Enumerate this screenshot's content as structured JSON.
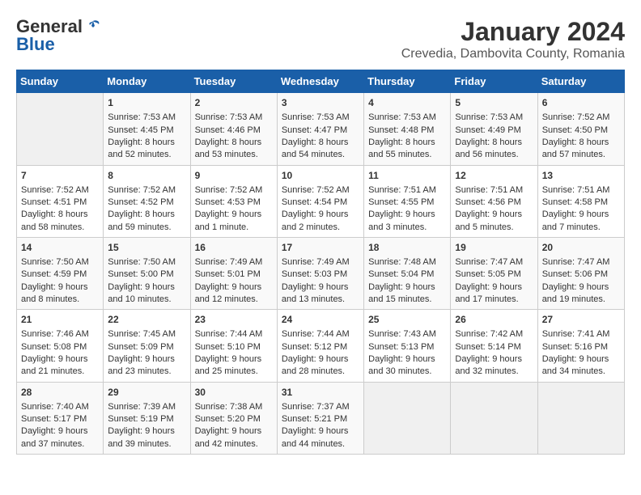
{
  "logo": {
    "general": "General",
    "blue": "Blue"
  },
  "title": "January 2024",
  "subtitle": "Crevedia, Dambovita County, Romania",
  "days_of_week": [
    "Sunday",
    "Monday",
    "Tuesday",
    "Wednesday",
    "Thursday",
    "Friday",
    "Saturday"
  ],
  "weeks": [
    [
      {
        "day": "",
        "content": ""
      },
      {
        "day": "1",
        "content": "Sunrise: 7:53 AM\nSunset: 4:45 PM\nDaylight: 8 hours\nand 52 minutes."
      },
      {
        "day": "2",
        "content": "Sunrise: 7:53 AM\nSunset: 4:46 PM\nDaylight: 8 hours\nand 53 minutes."
      },
      {
        "day": "3",
        "content": "Sunrise: 7:53 AM\nSunset: 4:47 PM\nDaylight: 8 hours\nand 54 minutes."
      },
      {
        "day": "4",
        "content": "Sunrise: 7:53 AM\nSunset: 4:48 PM\nDaylight: 8 hours\nand 55 minutes."
      },
      {
        "day": "5",
        "content": "Sunrise: 7:53 AM\nSunset: 4:49 PM\nDaylight: 8 hours\nand 56 minutes."
      },
      {
        "day": "6",
        "content": "Sunrise: 7:52 AM\nSunset: 4:50 PM\nDaylight: 8 hours\nand 57 minutes."
      }
    ],
    [
      {
        "day": "7",
        "content": "Sunrise: 7:52 AM\nSunset: 4:51 PM\nDaylight: 8 hours\nand 58 minutes."
      },
      {
        "day": "8",
        "content": "Sunrise: 7:52 AM\nSunset: 4:52 PM\nDaylight: 8 hours\nand 59 minutes."
      },
      {
        "day": "9",
        "content": "Sunrise: 7:52 AM\nSunset: 4:53 PM\nDaylight: 9 hours\nand 1 minute."
      },
      {
        "day": "10",
        "content": "Sunrise: 7:52 AM\nSunset: 4:54 PM\nDaylight: 9 hours\nand 2 minutes."
      },
      {
        "day": "11",
        "content": "Sunrise: 7:51 AM\nSunset: 4:55 PM\nDaylight: 9 hours\nand 3 minutes."
      },
      {
        "day": "12",
        "content": "Sunrise: 7:51 AM\nSunset: 4:56 PM\nDaylight: 9 hours\nand 5 minutes."
      },
      {
        "day": "13",
        "content": "Sunrise: 7:51 AM\nSunset: 4:58 PM\nDaylight: 9 hours\nand 7 minutes."
      }
    ],
    [
      {
        "day": "14",
        "content": "Sunrise: 7:50 AM\nSunset: 4:59 PM\nDaylight: 9 hours\nand 8 minutes."
      },
      {
        "day": "15",
        "content": "Sunrise: 7:50 AM\nSunset: 5:00 PM\nDaylight: 9 hours\nand 10 minutes."
      },
      {
        "day": "16",
        "content": "Sunrise: 7:49 AM\nSunset: 5:01 PM\nDaylight: 9 hours\nand 12 minutes."
      },
      {
        "day": "17",
        "content": "Sunrise: 7:49 AM\nSunset: 5:03 PM\nDaylight: 9 hours\nand 13 minutes."
      },
      {
        "day": "18",
        "content": "Sunrise: 7:48 AM\nSunset: 5:04 PM\nDaylight: 9 hours\nand 15 minutes."
      },
      {
        "day": "19",
        "content": "Sunrise: 7:47 AM\nSunset: 5:05 PM\nDaylight: 9 hours\nand 17 minutes."
      },
      {
        "day": "20",
        "content": "Sunrise: 7:47 AM\nSunset: 5:06 PM\nDaylight: 9 hours\nand 19 minutes."
      }
    ],
    [
      {
        "day": "21",
        "content": "Sunrise: 7:46 AM\nSunset: 5:08 PM\nDaylight: 9 hours\nand 21 minutes."
      },
      {
        "day": "22",
        "content": "Sunrise: 7:45 AM\nSunset: 5:09 PM\nDaylight: 9 hours\nand 23 minutes."
      },
      {
        "day": "23",
        "content": "Sunrise: 7:44 AM\nSunset: 5:10 PM\nDaylight: 9 hours\nand 25 minutes."
      },
      {
        "day": "24",
        "content": "Sunrise: 7:44 AM\nSunset: 5:12 PM\nDaylight: 9 hours\nand 28 minutes."
      },
      {
        "day": "25",
        "content": "Sunrise: 7:43 AM\nSunset: 5:13 PM\nDaylight: 9 hours\nand 30 minutes."
      },
      {
        "day": "26",
        "content": "Sunrise: 7:42 AM\nSunset: 5:14 PM\nDaylight: 9 hours\nand 32 minutes."
      },
      {
        "day": "27",
        "content": "Sunrise: 7:41 AM\nSunset: 5:16 PM\nDaylight: 9 hours\nand 34 minutes."
      }
    ],
    [
      {
        "day": "28",
        "content": "Sunrise: 7:40 AM\nSunset: 5:17 PM\nDaylight: 9 hours\nand 37 minutes."
      },
      {
        "day": "29",
        "content": "Sunrise: 7:39 AM\nSunset: 5:19 PM\nDaylight: 9 hours\nand 39 minutes."
      },
      {
        "day": "30",
        "content": "Sunrise: 7:38 AM\nSunset: 5:20 PM\nDaylight: 9 hours\nand 42 minutes."
      },
      {
        "day": "31",
        "content": "Sunrise: 7:37 AM\nSunset: 5:21 PM\nDaylight: 9 hours\nand 44 minutes."
      },
      {
        "day": "",
        "content": ""
      },
      {
        "day": "",
        "content": ""
      },
      {
        "day": "",
        "content": ""
      }
    ]
  ]
}
